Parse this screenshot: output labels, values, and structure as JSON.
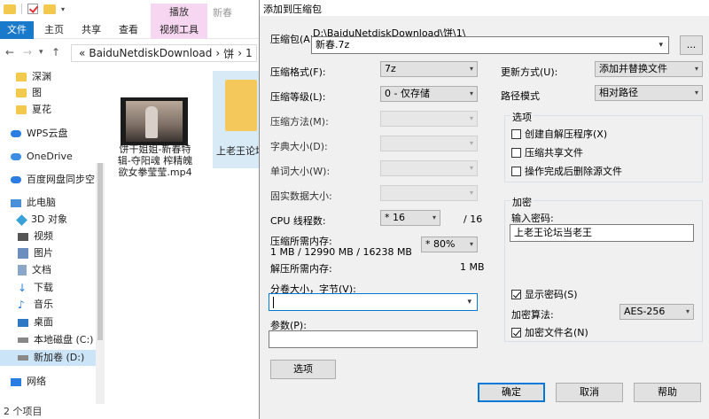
{
  "explorer": {
    "ribbon": {
      "context_group": "播放",
      "context_tab": "视频工具",
      "title_dim": "新春",
      "tabs": [
        "文件",
        "主页",
        "共享",
        "查看"
      ]
    },
    "address": {
      "prefix": "«",
      "path": "BaiduNetdiskDownload",
      "sep1": "›",
      "crumb2": "饼",
      "sep2": "›",
      "crumb3": "1",
      "sep3": "›"
    },
    "nav_items": [
      "深渊",
      "图",
      "夏花",
      "WPS云盘",
      "OneDrive",
      "百度网盘同步空间",
      "此电脑",
      "3D 对象",
      "视频",
      "图片",
      "文档",
      "下载",
      "音乐",
      "桌面",
      "本地磁盘 (C:)",
      "新加卷 (D:)",
      "网络"
    ],
    "files": [
      {
        "name": "饼干姐姐-新春特辑-夺阳魂 榨精魄欲女拳莹莹.mp4"
      },
      {
        "name": "上老王论坛当老王.zip"
      }
    ],
    "status": "2 个项目"
  },
  "dialog": {
    "title": "添加到压缩包",
    "archive_label": "压缩包(A)",
    "archive_dir": "D:\\BaiduNetdiskDownload\\饼\\1\\",
    "archive_name": "新春.7z",
    "browse_label": "...",
    "format_label": "压缩格式(F):",
    "format_value": "7z",
    "level_label": "压缩等级(L):",
    "level_value": "0 - 仅存储",
    "method_label": "压缩方法(M):",
    "dict_label": "字典大小(D):",
    "word_label": "单词大小(W):",
    "solid_label": "固实数据大小:",
    "cpu_label": "CPU 线程数:",
    "cpu_value": "* 16",
    "cpu_max": "/ 16",
    "mem_comp_label": "压缩所需内存:",
    "mem_comp_value": "1 MB / 12990 MB / 16238 MB",
    "mem_percent": "* 80%",
    "mem_decomp_label": "解压所需内存:",
    "mem_decomp_value": "1 MB",
    "split_label": "分卷大小，字节(V):",
    "params_label": "参数(P):",
    "options_button": "选项",
    "update_label": "更新方式(U):",
    "update_value": "添加并替换文件",
    "path_label": "路径模式",
    "path_value": "相对路径",
    "options_group": "选项",
    "opt_sfx": "创建自解压程序(X)",
    "opt_shared": "压缩共享文件",
    "opt_delete": "操作完成后删除源文件",
    "encrypt_group": "加密",
    "password_label": "输入密码:",
    "password_value": "上老王论坛当老王",
    "show_password": "显示密码(S)",
    "enc_method_label": "加密算法:",
    "enc_method_value": "AES-256",
    "encrypt_names": "加密文件名(N)",
    "ok_button": "确定",
    "cancel_button": "取消",
    "help_button": "帮助"
  }
}
